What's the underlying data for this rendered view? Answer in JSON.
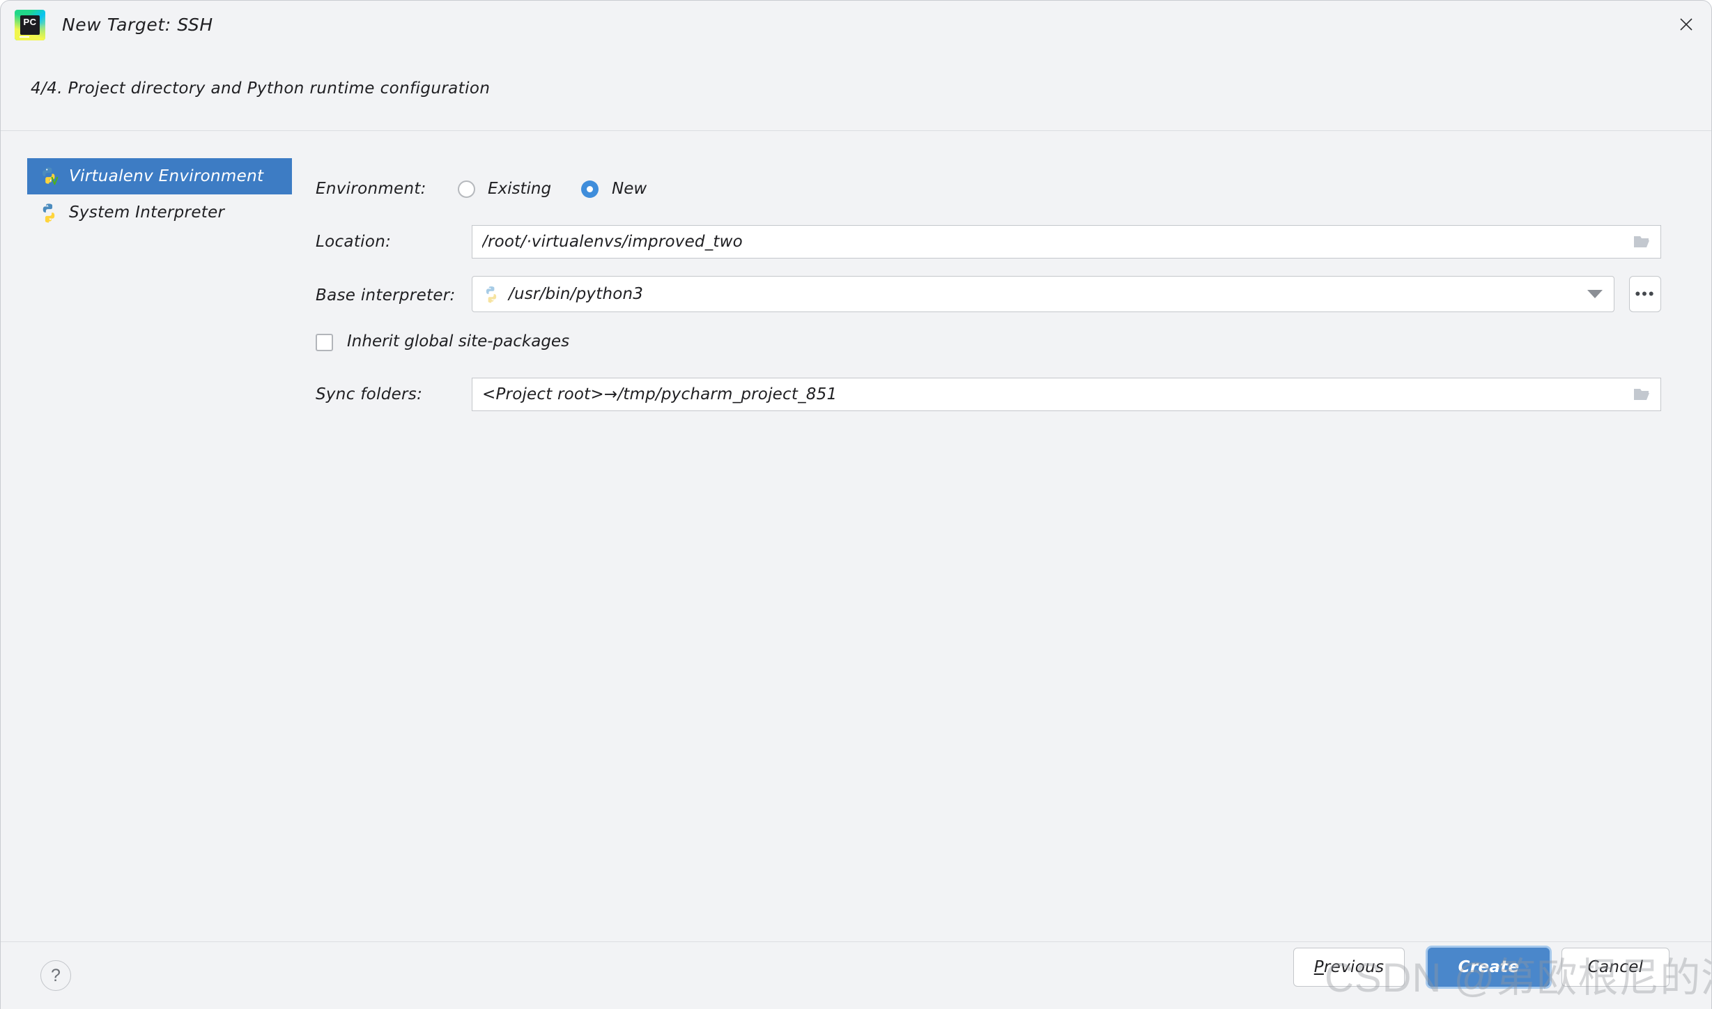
{
  "window": {
    "title": "New Target: SSH",
    "logo_icon": "pycharm-logo",
    "logo_text": "PC",
    "close_icon": "close-icon"
  },
  "subtitle": "4/4. Project directory and Python runtime configuration",
  "sidebar": {
    "items": [
      {
        "label": "Virtualenv Environment",
        "icon": "python-virtualenv-icon",
        "selected": true
      },
      {
        "label": "System Interpreter",
        "icon": "python-icon",
        "selected": false
      }
    ]
  },
  "form": {
    "environment": {
      "label": "Environment:",
      "options": [
        {
          "label": "Existing",
          "checked": false
        },
        {
          "label": "New",
          "checked": true
        }
      ]
    },
    "location": {
      "label": "Location:",
      "value": "/root/·virtualenvs/improved_two",
      "browse_icon": "folder-icon"
    },
    "base_interpreter": {
      "label": "Base interpreter:",
      "value": "/usr/bin/python3",
      "icon": "python-icon",
      "dropdown_icon": "chevron-down-icon",
      "more_label": "•••"
    },
    "inherit_site_packages": {
      "label": "Inherit global site-packages",
      "checked": false
    },
    "sync_folders": {
      "label": "Sync folders:",
      "value": "<Project root>→/tmp/pycharm_project_851",
      "browse_icon": "folder-icon"
    }
  },
  "footer": {
    "help_label": "?",
    "previous": {
      "mnemonic": "P",
      "rest": "revious"
    },
    "create_label": "Create",
    "cancel_label": "Cancel"
  },
  "watermark": "CSDN @第欧根尼的酒桶",
  "colors": {
    "accent": "#3d7cc4",
    "primary_button": "#4a87cb",
    "background": "#f2f3f5",
    "field_background": "#ffffff"
  }
}
